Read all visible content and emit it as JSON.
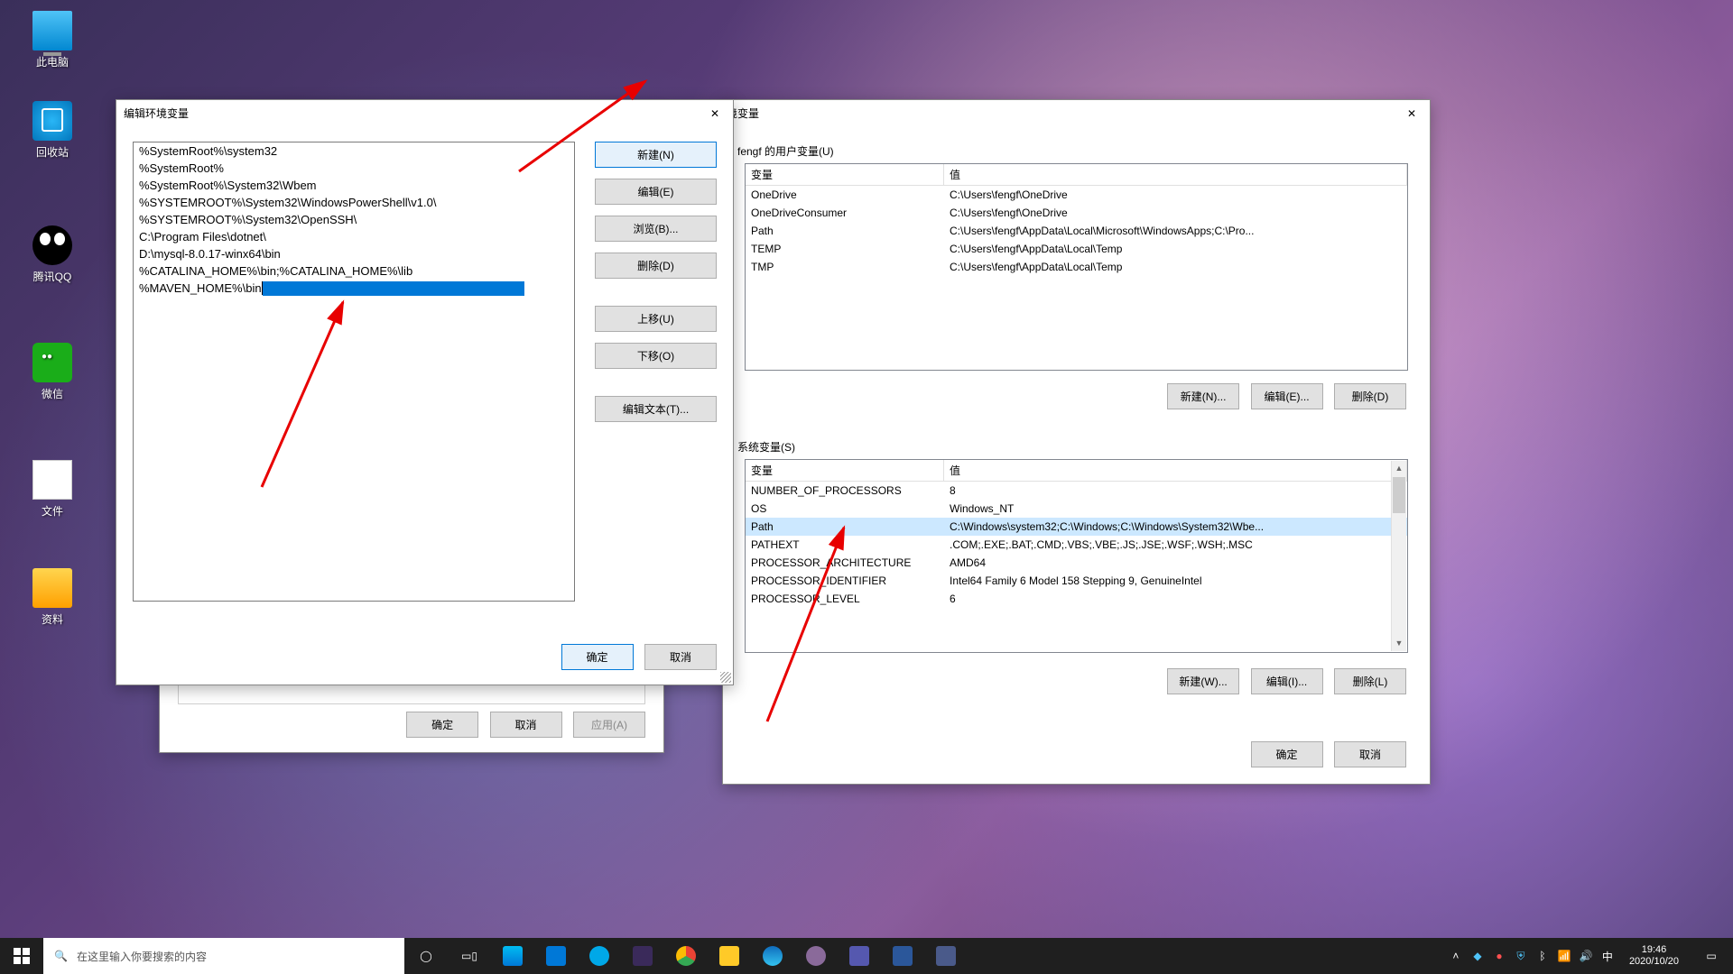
{
  "desktop": {
    "icons": [
      "此电脑",
      "回收站",
      "腾讯QQ",
      "微信",
      "文件",
      "资料"
    ]
  },
  "sysprop": {
    "ok": "确定",
    "cancel": "取消",
    "apply": "应用(A)"
  },
  "edit": {
    "title": "编辑环境变量",
    "rows": [
      "%SystemRoot%\\system32",
      "%SystemRoot%",
      "%SystemRoot%\\System32\\Wbem",
      "%SYSTEMROOT%\\System32\\WindowsPowerShell\\v1.0\\",
      "%SYSTEMROOT%\\System32\\OpenSSH\\",
      "C:\\Program Files\\dotnet\\",
      "D:\\mysql-8.0.17-winx64\\bin",
      "%CATALINA_HOME%\\bin;%CATALINA_HOME%\\lib"
    ],
    "editing": "%MAVEN_HOME%\\bin",
    "btn": {
      "new": "新建(N)",
      "edit": "编辑(E)",
      "browse": "浏览(B)...",
      "delete": "删除(D)",
      "up": "上移(U)",
      "down": "下移(O)",
      "text": "编辑文本(T)...",
      "ok": "确定",
      "cancel": "取消"
    }
  },
  "env": {
    "title": "境变量",
    "user_label": "fengf 的用户变量(U)",
    "sys_label": "系统变量(S)",
    "head_var": "变量",
    "head_val": "值",
    "user_vars": [
      {
        "k": "OneDrive",
        "v": "C:\\Users\\fengf\\OneDrive"
      },
      {
        "k": "OneDriveConsumer",
        "v": "C:\\Users\\fengf\\OneDrive"
      },
      {
        "k": "Path",
        "v": "C:\\Users\\fengf\\AppData\\Local\\Microsoft\\WindowsApps;C:\\Pro..."
      },
      {
        "k": "TEMP",
        "v": "C:\\Users\\fengf\\AppData\\Local\\Temp"
      },
      {
        "k": "TMP",
        "v": "C:\\Users\\fengf\\AppData\\Local\\Temp"
      }
    ],
    "sys_vars": [
      {
        "k": "NUMBER_OF_PROCESSORS",
        "v": "8"
      },
      {
        "k": "OS",
        "v": "Windows_NT"
      },
      {
        "k": "Path",
        "v": "C:\\Windows\\system32;C:\\Windows;C:\\Windows\\System32\\Wbe..."
      },
      {
        "k": "PATHEXT",
        "v": ".COM;.EXE;.BAT;.CMD;.VBS;.VBE;.JS;.JSE;.WSF;.WSH;.MSC"
      },
      {
        "k": "PROCESSOR_ARCHITECTURE",
        "v": "AMD64"
      },
      {
        "k": "PROCESSOR_IDENTIFIER",
        "v": "Intel64 Family 6 Model 158 Stepping 9, GenuineIntel"
      },
      {
        "k": "PROCESSOR_LEVEL",
        "v": "6"
      }
    ],
    "btn": {
      "newU": "新建(N)...",
      "editU": "编辑(E)...",
      "delU": "删除(D)",
      "newS": "新建(W)...",
      "editS": "编辑(I)...",
      "delS": "删除(L)",
      "ok": "确定",
      "cancel": "取消"
    }
  },
  "taskbar": {
    "search_placeholder": "在这里输入你要搜索的内容",
    "time": "19:46",
    "date": "2020/10/20",
    "ime": "中"
  }
}
